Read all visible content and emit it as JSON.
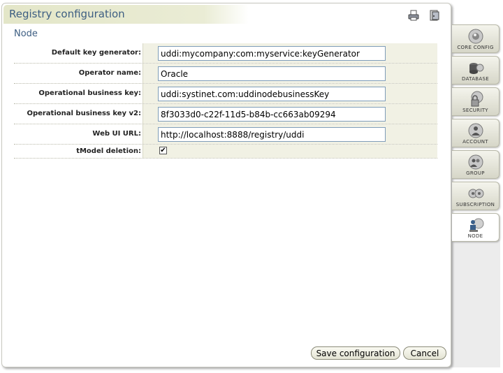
{
  "window": {
    "title": "Registry configuration"
  },
  "toolbar": {
    "print_icon": "printer-icon",
    "exit_icon": "exit-icon"
  },
  "section": {
    "title": "Node"
  },
  "form": {
    "fields": [
      {
        "label": "Default key generator:",
        "value": "uddi:mycompany:com:myservice:keyGenerator"
      },
      {
        "label": "Operator name:",
        "value": "Oracle"
      },
      {
        "label": "Operational business key:",
        "value": "uddi:systinet.com:uddinodebusinessKey"
      },
      {
        "label": "Operational business key v2:",
        "value": "8f3033d0-c22f-11d5-b84b-cc663ab09294"
      },
      {
        "label": "Web UI URL:",
        "value": "http://localhost:8888/registry/uddi"
      }
    ],
    "tmodel": {
      "label": "tModel deletion:",
      "checked": true,
      "mark": "✔"
    }
  },
  "buttons": {
    "save": "Save configuration",
    "cancel": "Cancel"
  },
  "tabs": [
    {
      "label": "CORE CONFIG",
      "icon": "core-config-icon"
    },
    {
      "label": "DATABASE",
      "icon": "database-icon"
    },
    {
      "label": "SECURITY",
      "icon": "security-icon"
    },
    {
      "label": "ACCOUNT",
      "icon": "account-icon"
    },
    {
      "label": "GROUP",
      "icon": "group-icon"
    },
    {
      "label": "SUBSCRIPTION",
      "icon": "subscription-icon"
    },
    {
      "label": "NODE",
      "icon": "node-icon",
      "active": true
    }
  ]
}
